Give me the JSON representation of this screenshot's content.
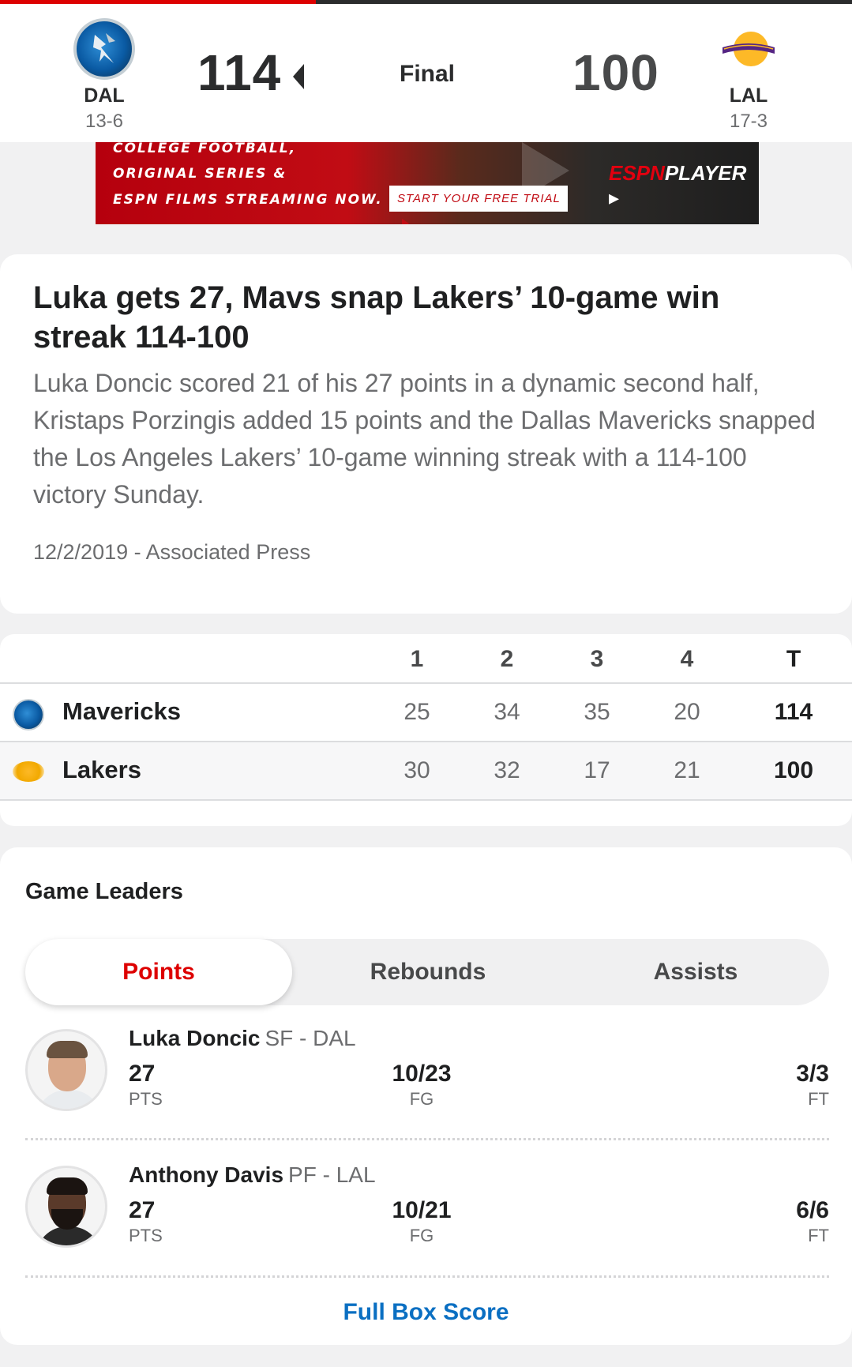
{
  "scoreboard": {
    "away": {
      "abbr": "DAL",
      "record": "13-6",
      "score": "114",
      "logo_icon": "mavericks-logo-icon"
    },
    "home": {
      "abbr": "LAL",
      "record": "17-3",
      "score": "100",
      "logo_icon": "lakers-logo-icon"
    },
    "status": "Final"
  },
  "ad": {
    "line1": "COLLEGE FOOTBALL,",
    "line2": "ORIGINAL SERIES &",
    "line3": "ESPN FILMS STREAMING NOW.",
    "cta": "START YOUR FREE TRIAL",
    "brand_espn": "ESPN",
    "brand_player": "PLAYER"
  },
  "story": {
    "headline": "Luka gets 27, Mavs snap Lakers’ 10-game win streak 114-100",
    "summary": "Luka Doncic scored 21 of his 27 points in a dynamic second half, Kristaps Porzingis added 15 points and the Dallas Mavericks snapped the Los Angeles Lakers’ 10-game winning streak with a 114-100 victory Sunday.",
    "meta": "12/2/2019 - Associated Press"
  },
  "linescore": {
    "headers": [
      "1",
      "2",
      "3",
      "4",
      "T"
    ],
    "rows": [
      {
        "team": "Mavericks",
        "q": [
          "25",
          "34",
          "35",
          "20"
        ],
        "total": "114"
      },
      {
        "team": "Lakers",
        "q": [
          "30",
          "32",
          "17",
          "21"
        ],
        "total": "100"
      }
    ]
  },
  "leaders": {
    "title": "Game Leaders",
    "tabs": [
      "Points",
      "Rebounds",
      "Assists"
    ],
    "selected_tab": "Points",
    "players": [
      {
        "name": "Luka Doncic",
        "pos": "SF - DAL",
        "pts": "27",
        "pts_label": "PTS",
        "fg": "10/23",
        "fg_label": "FG",
        "ft": "3/3",
        "ft_label": "FT"
      },
      {
        "name": "Anthony Davis",
        "pos": "PF - LAL",
        "pts": "27",
        "pts_label": "PTS",
        "fg": "10/21",
        "fg_label": "FG",
        "ft": "6/6",
        "ft_label": "FT"
      }
    ],
    "box_score_link": "Full Box Score"
  },
  "colors": {
    "accent": "#dd0000",
    "link": "#0a6fc2",
    "text": "#2b2c2d",
    "muted": "#6c6d6f"
  }
}
